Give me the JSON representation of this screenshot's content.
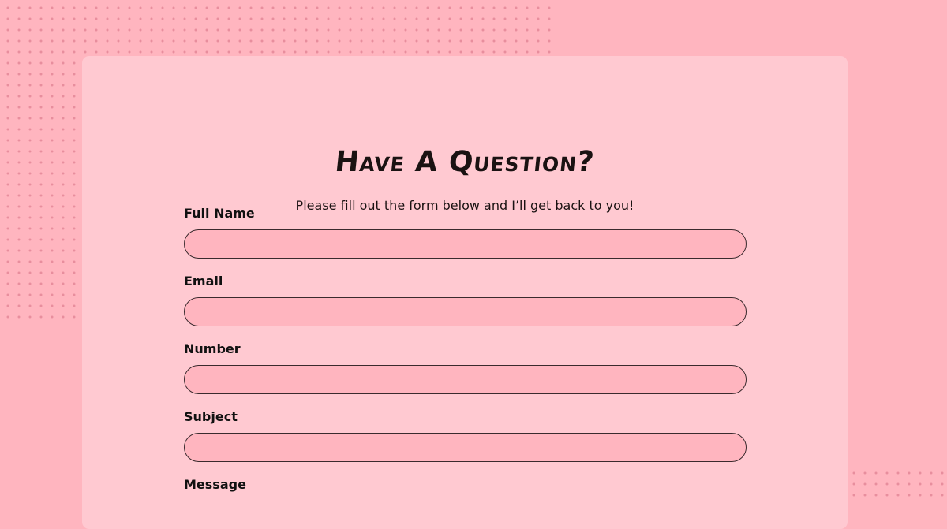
{
  "header": {
    "title": "Have A Question?",
    "subtitle": "Please fill out the form below and I’ll get back to you!"
  },
  "form": {
    "fields": [
      {
        "label": "Full Name",
        "value": ""
      },
      {
        "label": "Email",
        "value": ""
      },
      {
        "label": "Number",
        "value": ""
      },
      {
        "label": "Subject",
        "value": ""
      }
    ],
    "message_label": "Message"
  },
  "colors": {
    "background": "#ffb5bf",
    "card": "#ffc9d1",
    "input_fill": "#ffb5bf",
    "text": "#1a1212"
  }
}
